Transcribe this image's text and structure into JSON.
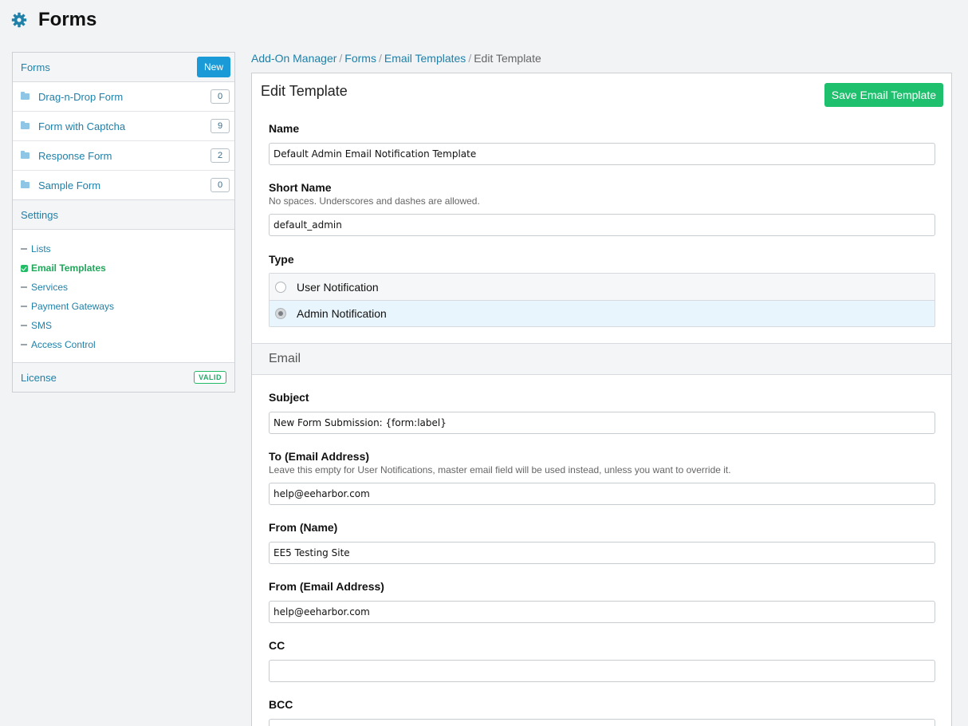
{
  "header": {
    "title": "Forms",
    "icon": "gear-icon",
    "accent": "#1f80a8"
  },
  "sidebar": {
    "forms_label": "Forms",
    "new_label": "New",
    "forms": [
      {
        "label": "Drag-n-Drop Form",
        "count": "0"
      },
      {
        "label": "Form with Captcha",
        "count": "9"
      },
      {
        "label": "Response Form",
        "count": "2"
      },
      {
        "label": "Sample Form",
        "count": "0"
      }
    ],
    "settings_label": "Settings",
    "settings": [
      {
        "label": "Lists"
      },
      {
        "label": "Email Templates",
        "active": true
      },
      {
        "label": "Services"
      },
      {
        "label": "Payment Gateways"
      },
      {
        "label": "SMS"
      },
      {
        "label": "Access Control"
      }
    ],
    "license_label": "License",
    "license_status": "VALID"
  },
  "breadcrumb": {
    "items": [
      "Add-On Manager",
      "Forms",
      "Email Templates"
    ],
    "current": "Edit Template"
  },
  "panel": {
    "title": "Edit Template",
    "save_label": "Save Email Template",
    "name": {
      "label": "Name",
      "value": "Default Admin Email Notification Template"
    },
    "short_name": {
      "label": "Short Name",
      "hint": "No spaces. Underscores and dashes are allowed.",
      "value": "default_admin"
    },
    "type": {
      "label": "Type",
      "options": [
        "User Notification",
        "Admin Notification"
      ],
      "selected": "Admin Notification"
    },
    "email_section": "Email",
    "subject": {
      "label": "Subject",
      "value": "New Form Submission: {form:label}"
    },
    "to": {
      "label": "To (Email Address)",
      "hint": "Leave this empty for User Notifications, master email field will be used instead, unless you want to override it.",
      "value": "help@eeharbor.com"
    },
    "from_name": {
      "label": "From (Name)",
      "value": "EE5 Testing Site"
    },
    "from_email": {
      "label": "From (Email Address)",
      "value": "help@eeharbor.com"
    },
    "cc": {
      "label": "CC",
      "value": ""
    },
    "bcc": {
      "label": "BCC",
      "value": ""
    }
  }
}
